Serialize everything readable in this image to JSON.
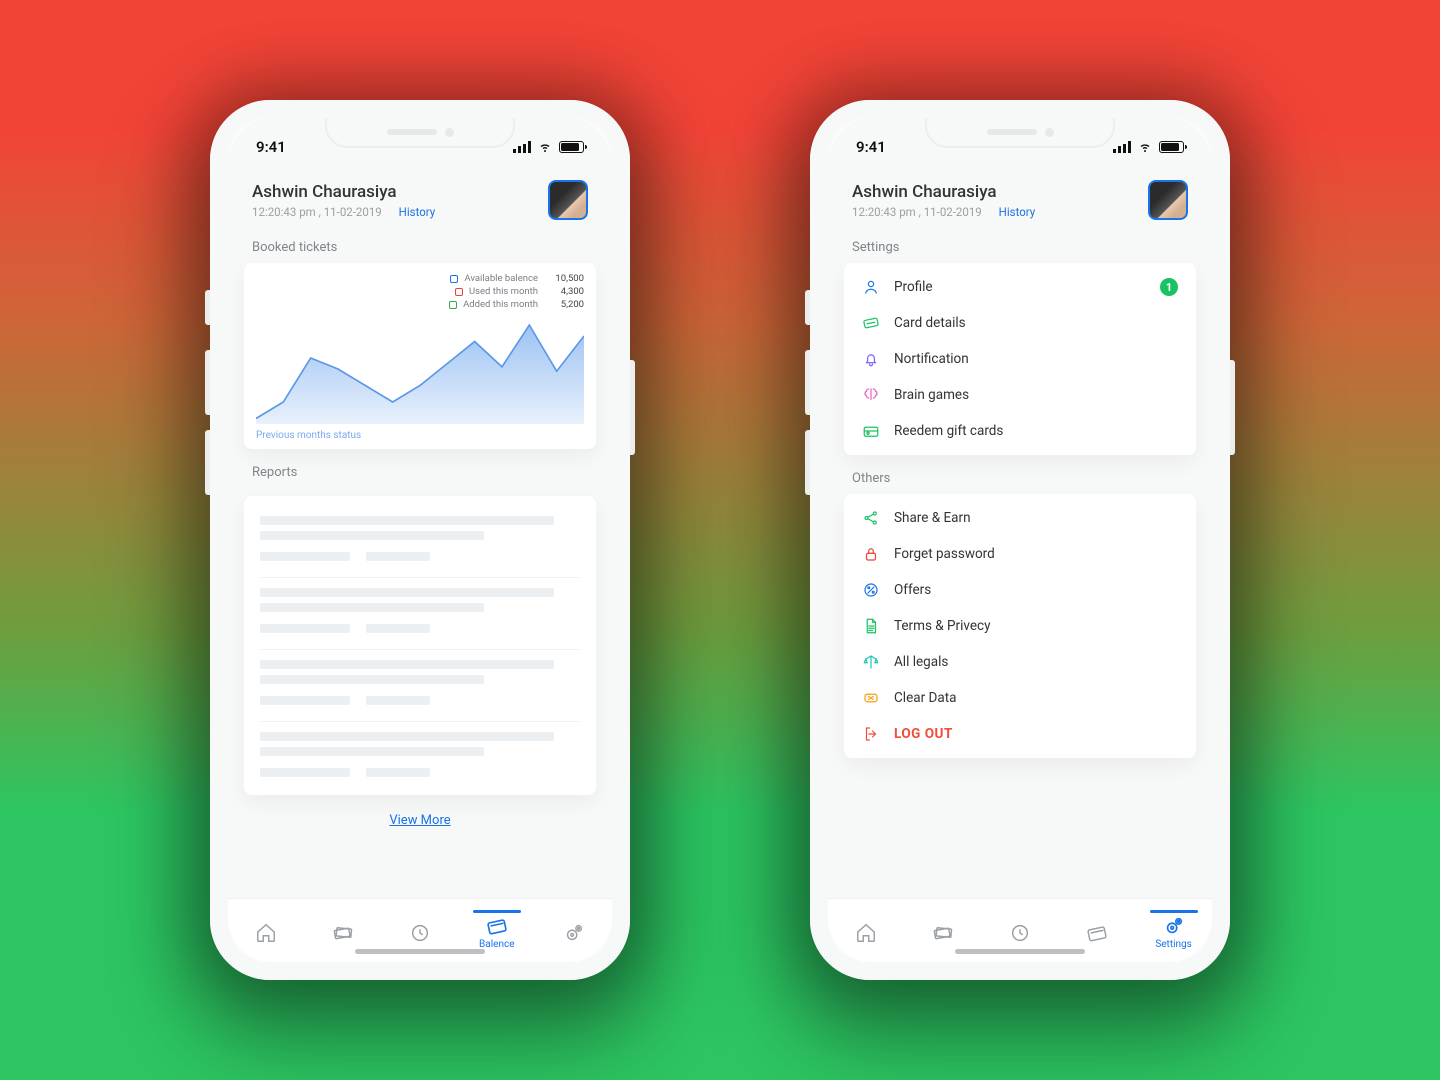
{
  "status_time": "9:41",
  "header": {
    "name": "Ashwin Chaurasiya",
    "timestamp": "12:20:43 pm , 11-02-2019",
    "history_label": "History"
  },
  "balance_screen": {
    "section_booked": "Booked tickets",
    "section_reports": "Reports",
    "legend": [
      {
        "label": "Available balence",
        "value": "10,500"
      },
      {
        "label": "Used this month",
        "value": "4,300"
      },
      {
        "label": "Added this month",
        "value": "5,200"
      }
    ],
    "chart_footer": "Previous months status",
    "view_more": "View More"
  },
  "settings_screen": {
    "section_settings": "Settings",
    "section_others": "Others",
    "settings_items": [
      {
        "label": "Profile",
        "icon": "user-icon",
        "color": "#1a73e8",
        "badge": "1"
      },
      {
        "label": "Card details",
        "icon": "ticket-icon",
        "color": "#17c363"
      },
      {
        "label": "Nortification",
        "icon": "bell-icon",
        "color": "#7b61ff"
      },
      {
        "label": "Brain games",
        "icon": "brain-icon",
        "color": "#e860b6"
      },
      {
        "label": "Reedem gift cards",
        "icon": "gift-card-icon",
        "color": "#17c363"
      }
    ],
    "others_items": [
      {
        "label": "Share & Earn",
        "icon": "share-icon",
        "color": "#17c363"
      },
      {
        "label": "Forget password",
        "icon": "lock-icon",
        "color": "#ea4335"
      },
      {
        "label": "Offers",
        "icon": "percent-icon",
        "color": "#1a73e8"
      },
      {
        "label": "Terms & Privecy",
        "icon": "doc-icon",
        "color": "#17c363"
      },
      {
        "label": "All legals",
        "icon": "scale-icon",
        "color": "#1bc7b5"
      },
      {
        "label": "Clear Data",
        "icon": "clear-icon",
        "color": "#f59e0b"
      },
      {
        "label": "LOG OUT",
        "icon": "logout-icon",
        "color": "#f04d3b",
        "danger": true
      }
    ]
  },
  "tabs": {
    "items": [
      "home-icon",
      "tickets-icon",
      "clock-icon",
      "card-icon",
      "settings-icon"
    ],
    "balance_label": "Balence",
    "settings_label": "Settings"
  },
  "chart_data": {
    "type": "area",
    "title": "Booked tickets",
    "series": [
      {
        "name": "Available balence",
        "color": "#1a73e8"
      },
      {
        "name": "Used this month",
        "color": "#ea4335"
      },
      {
        "name": "Added this month",
        "color": "#34a853"
      }
    ],
    "x": [
      1,
      2,
      3,
      4,
      5,
      6,
      7,
      8,
      9,
      10,
      11,
      12,
      13
    ],
    "values": [
      5,
      20,
      60,
      50,
      35,
      20,
      35,
      55,
      75,
      52,
      90,
      48,
      80
    ],
    "ylim": [
      0,
      100
    ],
    "xlabel": "",
    "ylabel": ""
  }
}
